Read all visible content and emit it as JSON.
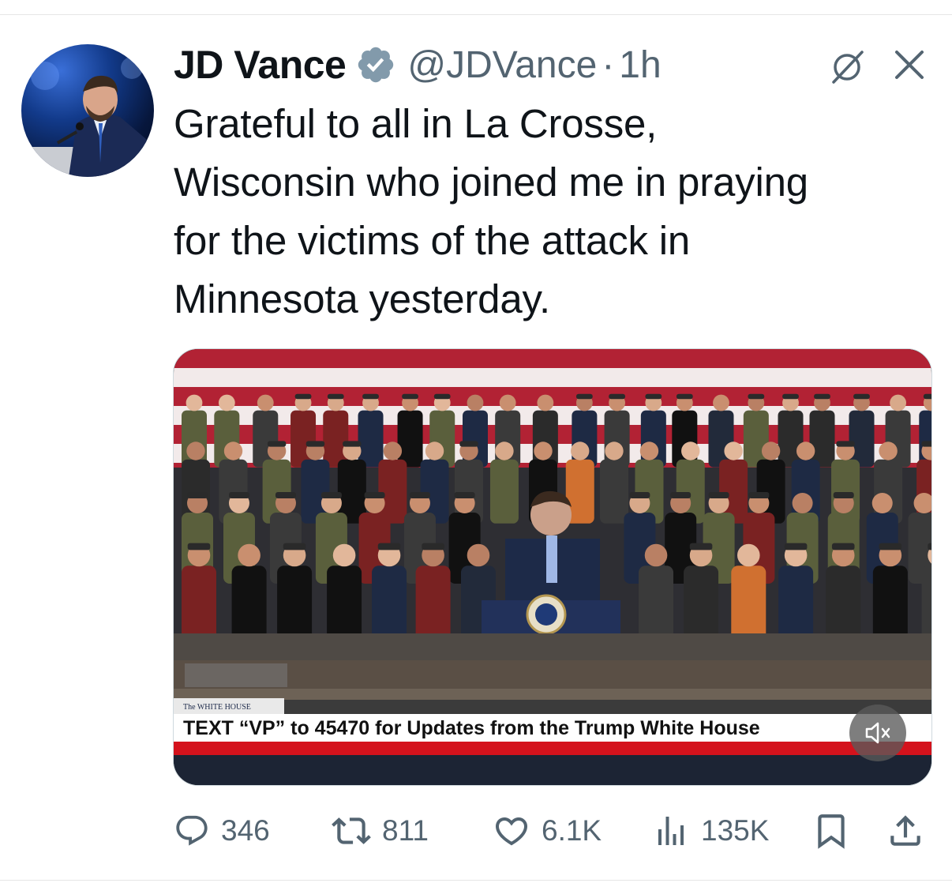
{
  "tweet": {
    "author_name": "JD Vance",
    "handle": "@JDVance",
    "separator": "·",
    "time": "1h",
    "text": "Grateful to all in La Crosse,\nWisconsin who joined me in praying\nfor the victims of the attack in\nMinnesota yesterday.",
    "media": {
      "chyron_brand": "The WHITE HOUSE",
      "chyron_text": "TEXT “VP” to 45470 for Updates from the Trump White House"
    }
  },
  "actions": {
    "replies": "346",
    "reposts": "811",
    "likes": "6.1K",
    "views": "135K"
  },
  "icons": [
    "verified-badge-icon",
    "grok-icon",
    "close-icon",
    "mute-icon",
    "reply-icon",
    "repost-icon",
    "like-icon",
    "views-icon",
    "bookmark-icon",
    "share-icon"
  ],
  "colors": {
    "verified": "#829aab",
    "secondary_text": "#536471",
    "chyron_red": "#d4121c"
  }
}
